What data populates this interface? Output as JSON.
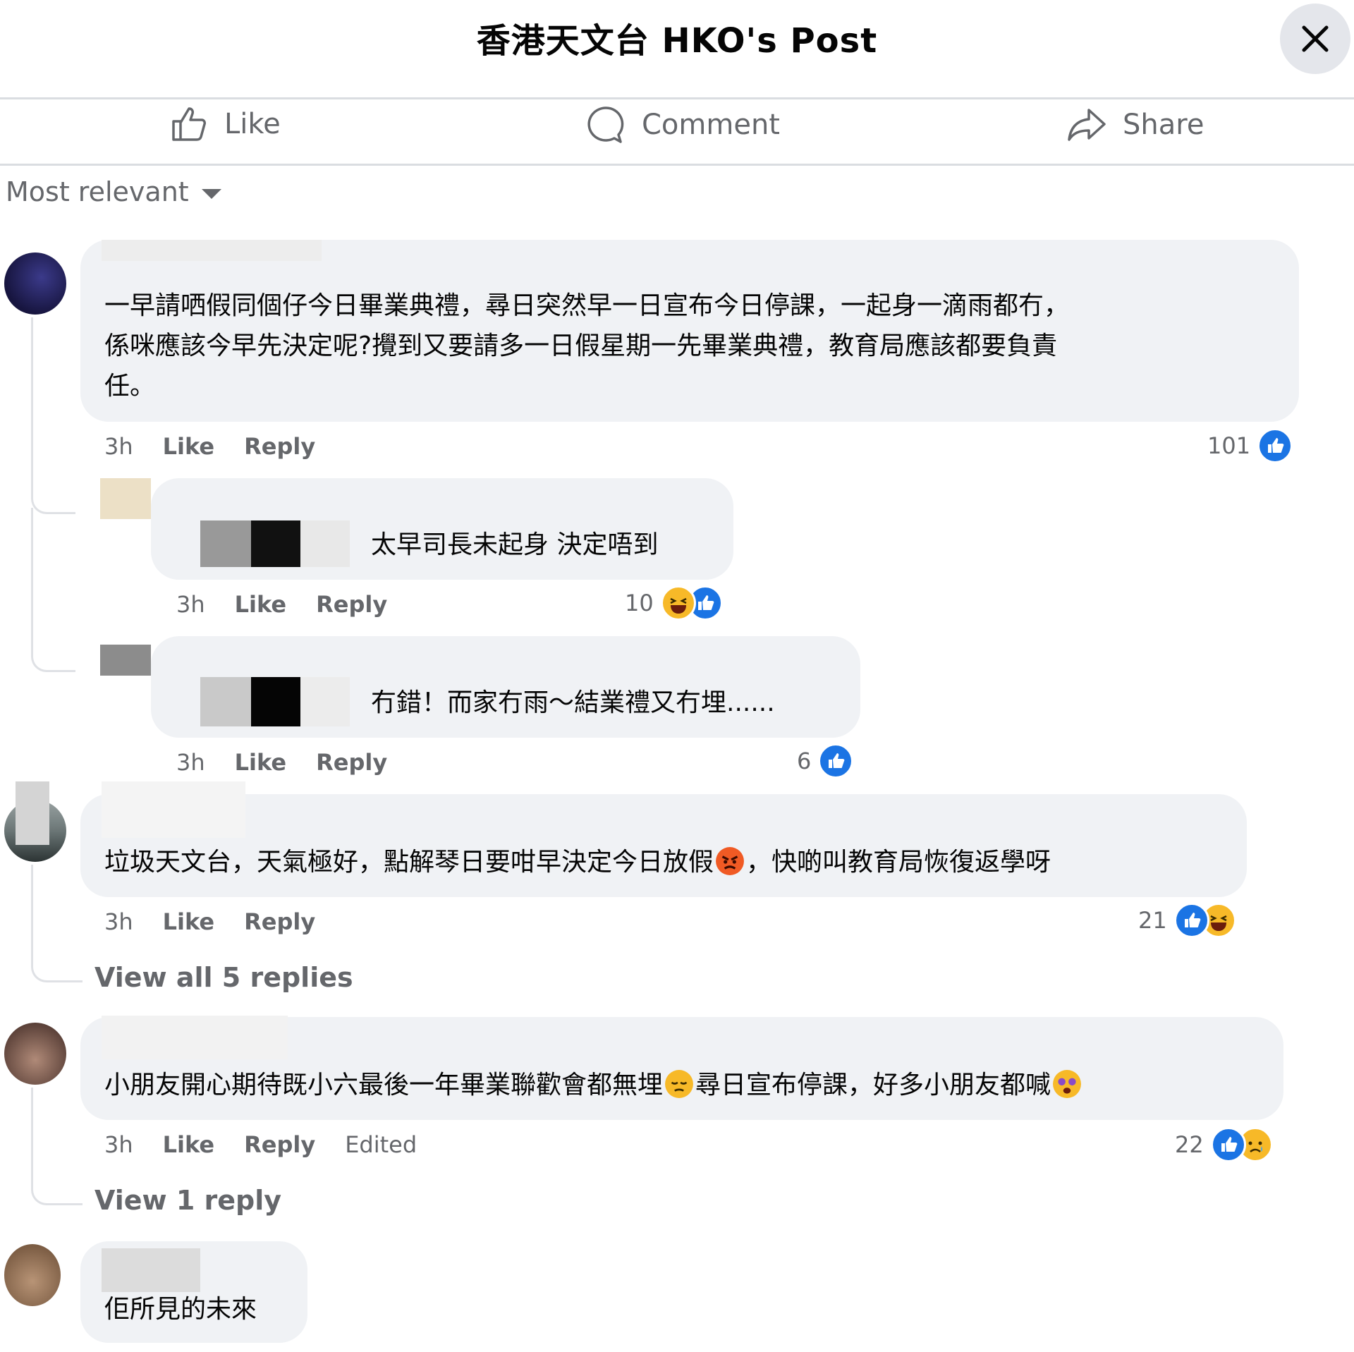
{
  "header": {
    "title": "香港天文台 HKO's Post"
  },
  "actions": {
    "like_label": "Like",
    "comment_label": "Comment",
    "share_label": "Share"
  },
  "sort": {
    "label": "Most relevant"
  },
  "comments": [
    {
      "text": "一早請哂假同個仔今日畢業典禮，尋日突然早一日宣布今日停課，一起身一滴雨都冇，\n係咪應該今早先決定呢?攪到又要請多一日假星期一先畢業典禮，教育局應該都要負責\n任。",
      "time": "3h",
      "like": "Like",
      "reply": "Reply",
      "reactions": "101",
      "replies": [
        {
          "text": "太早司長未起身 決定唔到",
          "time": "3h",
          "like": "Like",
          "reply": "Reply",
          "reactions": "10"
        },
        {
          "text": "冇錯！而家冇雨～結業禮又冇埋......",
          "time": "3h",
          "like": "Like",
          "reply": "Reply",
          "reactions": "6"
        }
      ]
    },
    {
      "text_before": "垃圾天文台，天氣極好，點解琴日要咁早決定今日放假",
      "text_after": "，快啲叫教育局恢復返學呀",
      "time": "3h",
      "like": "Like",
      "reply": "Reply",
      "reactions": "21",
      "view_replies": "View all 5 replies"
    },
    {
      "text_before": "小朋友開心期待既小六最後一年畢業聯歡會都無埋",
      "text_middle": "尋日宣布停課，好多小朋友都喊",
      "time": "3h",
      "like": "Like",
      "reply": "Reply",
      "edited": "Edited",
      "reactions": "22",
      "view_replies": "View 1 reply"
    },
    {
      "text": "佢所見的未來"
    }
  ],
  "colors": {
    "like_blue": "#1b74e4",
    "emoji_yellow": "#f7b928",
    "bubble_bg": "#f0f2f5",
    "secondary_text": "#65676b"
  }
}
